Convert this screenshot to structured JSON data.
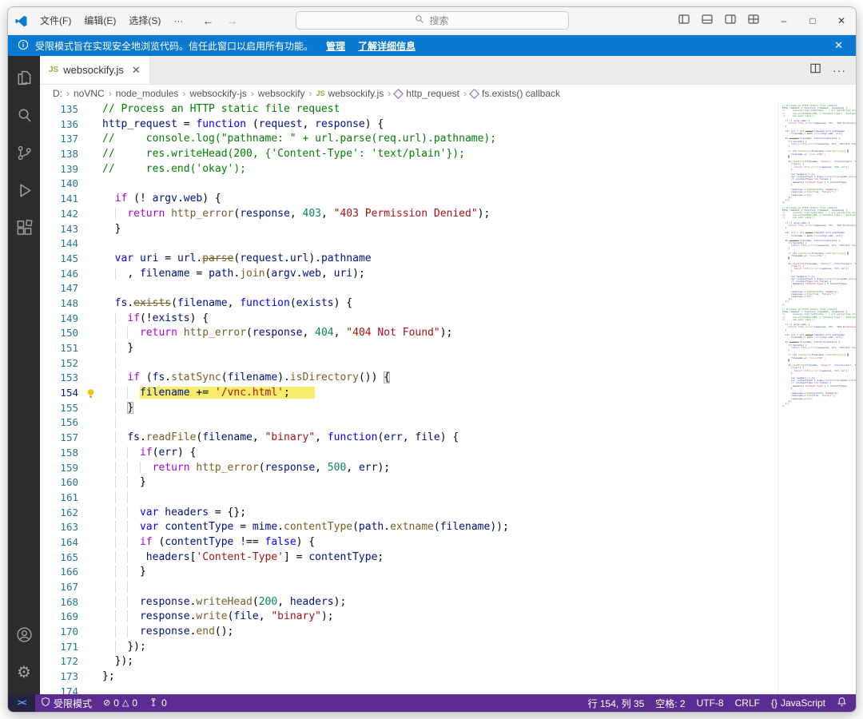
{
  "colors": {
    "status_bar": "#5c2d91",
    "banner": "#0a79d1",
    "activity_bar": "#2c2c2c",
    "highlight": "#f7ec6c",
    "accent_blue": "#0c7bd6"
  },
  "titlebar": {
    "menus": [
      "文件(F)",
      "编辑(E)",
      "选择(S)",
      "···"
    ],
    "nav": {
      "back": "←",
      "forward": "→"
    },
    "search_placeholder": "搜索",
    "window_controls": {
      "minimize": "–",
      "maximize": "□",
      "close": "✕"
    }
  },
  "banner": {
    "message": "受限模式旨在实现安全地浏览代码。信任此窗口以启用所有功能。",
    "manage_link": "管理",
    "learn_more_link": "了解详细信息",
    "close": "✕"
  },
  "activity_bar": {
    "items": [
      "explorer",
      "search",
      "source-control",
      "run-and-debug",
      "extensions",
      "account",
      "settings"
    ]
  },
  "tab": {
    "icon_label": "JS",
    "label": "websockify.js",
    "close": "✕"
  },
  "breadcrumb": {
    "items": [
      {
        "label": "D:"
      },
      {
        "label": "noVNC"
      },
      {
        "label": "node_modules"
      },
      {
        "label": "websockify-js"
      },
      {
        "label": "websockify"
      },
      {
        "label": "websockify.js",
        "icon": "js"
      },
      {
        "label": "http_request",
        "icon": "symbol"
      },
      {
        "label": "fs.exists() callback",
        "icon": "symbol"
      }
    ]
  },
  "code": {
    "lines": [
      {
        "n": 135,
        "i": 0,
        "t": [
          [
            "c",
            "// Process an HTTP static file request"
          ]
        ]
      },
      {
        "n": 136,
        "i": 0,
        "t": [
          [
            "v",
            "http_request"
          ],
          [
            "p",
            " = "
          ],
          [
            "k",
            "function"
          ],
          [
            "p",
            " ("
          ],
          [
            "v",
            "request"
          ],
          [
            "p",
            ", "
          ],
          [
            "v",
            "response"
          ],
          [
            "p",
            ") {"
          ]
        ]
      },
      {
        "n": 137,
        "i": 0,
        "t": [
          [
            "c",
            "//     console.log(\"pathname: \" + url.parse(req.url).pathname);"
          ]
        ]
      },
      {
        "n": 138,
        "i": 0,
        "t": [
          [
            "c",
            "//     res.writeHead(200, {'Content-Type': 'text/plain'});"
          ]
        ]
      },
      {
        "n": 139,
        "i": 0,
        "t": [
          [
            "c",
            "//     res.end('okay');"
          ]
        ]
      },
      {
        "n": 140,
        "i": 2,
        "t": []
      },
      {
        "n": 141,
        "i": 2,
        "t": [
          [
            "kc",
            "if"
          ],
          [
            "p",
            " (! "
          ],
          [
            "v",
            "argv"
          ],
          [
            "p",
            "."
          ],
          [
            "v",
            "web"
          ],
          [
            "p",
            ") {"
          ]
        ]
      },
      {
        "n": 142,
        "i": 4,
        "t": [
          [
            "kc",
            "return"
          ],
          [
            "p",
            " "
          ],
          [
            "f",
            "http_error"
          ],
          [
            "p",
            "("
          ],
          [
            "v",
            "response"
          ],
          [
            "p",
            ", "
          ],
          [
            "n",
            "403"
          ],
          [
            "p",
            ", "
          ],
          [
            "s",
            "\"403 Permission Denied\""
          ],
          [
            "p",
            ");"
          ]
        ]
      },
      {
        "n": 143,
        "i": 2,
        "t": [
          [
            "p",
            "}"
          ]
        ]
      },
      {
        "n": 144,
        "i": 2,
        "t": []
      },
      {
        "n": 145,
        "i": 2,
        "t": [
          [
            "k",
            "var"
          ],
          [
            "p",
            " "
          ],
          [
            "v",
            "uri"
          ],
          [
            "p",
            " = "
          ],
          [
            "v",
            "url"
          ],
          [
            "p",
            "."
          ],
          [
            "fd",
            "parse"
          ],
          [
            "p",
            "("
          ],
          [
            "v",
            "request"
          ],
          [
            "p",
            "."
          ],
          [
            "v",
            "url"
          ],
          [
            "p",
            ")."
          ],
          [
            "v",
            "pathname"
          ]
        ]
      },
      {
        "n": 146,
        "i": 4,
        "t": [
          [
            "p",
            ", "
          ],
          [
            "v",
            "filename"
          ],
          [
            "p",
            " = "
          ],
          [
            "v",
            "path"
          ],
          [
            "p",
            "."
          ],
          [
            "f",
            "join"
          ],
          [
            "p",
            "("
          ],
          [
            "v",
            "argv"
          ],
          [
            "p",
            "."
          ],
          [
            "v",
            "web"
          ],
          [
            "p",
            ", "
          ],
          [
            "v",
            "uri"
          ],
          [
            "p",
            ");"
          ]
        ]
      },
      {
        "n": 147,
        "i": 2,
        "t": []
      },
      {
        "n": 148,
        "i": 2,
        "t": [
          [
            "v",
            "fs"
          ],
          [
            "p",
            "."
          ],
          [
            "fd",
            "exists"
          ],
          [
            "p",
            "("
          ],
          [
            "v",
            "filename"
          ],
          [
            "p",
            ", "
          ],
          [
            "k",
            "function"
          ],
          [
            "p",
            "("
          ],
          [
            "v",
            "exists"
          ],
          [
            "p",
            ") {"
          ]
        ]
      },
      {
        "n": 149,
        "i": 4,
        "t": [
          [
            "kc",
            "if"
          ],
          [
            "p",
            "(!"
          ],
          [
            "v",
            "exists"
          ],
          [
            "p",
            ") {"
          ]
        ]
      },
      {
        "n": 150,
        "i": 6,
        "t": [
          [
            "kc",
            "return"
          ],
          [
            "p",
            " "
          ],
          [
            "f",
            "http_error"
          ],
          [
            "p",
            "("
          ],
          [
            "v",
            "response"
          ],
          [
            "p",
            ", "
          ],
          [
            "n",
            "404"
          ],
          [
            "p",
            ", "
          ],
          [
            "s",
            "\"404 Not Found\""
          ],
          [
            "p",
            ");"
          ]
        ]
      },
      {
        "n": 151,
        "i": 4,
        "t": [
          [
            "p",
            "}"
          ]
        ]
      },
      {
        "n": 152,
        "i": 4,
        "t": []
      },
      {
        "n": 153,
        "i": 4,
        "t": [
          [
            "kc",
            "if"
          ],
          [
            "p",
            " ("
          ],
          [
            "v",
            "fs"
          ],
          [
            "p",
            "."
          ],
          [
            "f",
            "statSync"
          ],
          [
            "p",
            "("
          ],
          [
            "v",
            "filename"
          ],
          [
            "p",
            ")."
          ],
          [
            "f",
            "isDirectory"
          ],
          [
            "p",
            "()) "
          ],
          [
            "bm",
            "{"
          ]
        ]
      },
      {
        "n": 154,
        "i": 6,
        "hl": true,
        "bulb": true,
        "cur": true,
        "t": [
          [
            "v",
            "filename"
          ],
          [
            "p",
            " += "
          ],
          [
            "s",
            "'/vnc.html'"
          ],
          [
            "p",
            ";    "
          ]
        ]
      },
      {
        "n": 155,
        "i": 4,
        "t": [
          [
            "bm",
            "}"
          ]
        ]
      },
      {
        "n": 156,
        "i": 4,
        "t": []
      },
      {
        "n": 157,
        "i": 4,
        "t": [
          [
            "v",
            "fs"
          ],
          [
            "p",
            "."
          ],
          [
            "f",
            "readFile"
          ],
          [
            "p",
            "("
          ],
          [
            "v",
            "filename"
          ],
          [
            "p",
            ", "
          ],
          [
            "s",
            "\"binary\""
          ],
          [
            "p",
            ", "
          ],
          [
            "k",
            "function"
          ],
          [
            "p",
            "("
          ],
          [
            "v",
            "err"
          ],
          [
            "p",
            ", "
          ],
          [
            "v",
            "file"
          ],
          [
            "p",
            ") {"
          ]
        ]
      },
      {
        "n": 158,
        "i": 6,
        "t": [
          [
            "kc",
            "if"
          ],
          [
            "p",
            "("
          ],
          [
            "v",
            "err"
          ],
          [
            "p",
            ") {"
          ]
        ]
      },
      {
        "n": 159,
        "i": 8,
        "t": [
          [
            "kc",
            "return"
          ],
          [
            "p",
            " "
          ],
          [
            "f",
            "http_error"
          ],
          [
            "p",
            "("
          ],
          [
            "v",
            "response"
          ],
          [
            "p",
            ", "
          ],
          [
            "n",
            "500"
          ],
          [
            "p",
            ", "
          ],
          [
            "v",
            "err"
          ],
          [
            "p",
            ");"
          ]
        ]
      },
      {
        "n": 160,
        "i": 6,
        "t": [
          [
            "p",
            "}"
          ]
        ]
      },
      {
        "n": 161,
        "i": 6,
        "t": []
      },
      {
        "n": 162,
        "i": 6,
        "t": [
          [
            "k",
            "var"
          ],
          [
            "p",
            " "
          ],
          [
            "v",
            "headers"
          ],
          [
            "p",
            " = {};"
          ]
        ]
      },
      {
        "n": 163,
        "i": 6,
        "t": [
          [
            "k",
            "var"
          ],
          [
            "p",
            " "
          ],
          [
            "v",
            "contentType"
          ],
          [
            "p",
            " = "
          ],
          [
            "v",
            "mime"
          ],
          [
            "p",
            "."
          ],
          [
            "f",
            "contentType"
          ],
          [
            "p",
            "("
          ],
          [
            "v",
            "path"
          ],
          [
            "p",
            "."
          ],
          [
            "f",
            "extname"
          ],
          [
            "p",
            "("
          ],
          [
            "v",
            "filename"
          ],
          [
            "p",
            "));"
          ]
        ]
      },
      {
        "n": 164,
        "i": 6,
        "t": [
          [
            "kc",
            "if"
          ],
          [
            "p",
            " ("
          ],
          [
            "v",
            "contentType"
          ],
          [
            "p",
            " !== "
          ],
          [
            "k",
            "false"
          ],
          [
            "p",
            ") {"
          ]
        ]
      },
      {
        "n": 165,
        "i": 7,
        "t": [
          [
            "v",
            "headers"
          ],
          [
            "p",
            "["
          ],
          [
            "s",
            "'Content-Type'"
          ],
          [
            "p",
            "] = "
          ],
          [
            "v",
            "contentType"
          ],
          [
            "p",
            ";"
          ]
        ]
      },
      {
        "n": 166,
        "i": 6,
        "t": [
          [
            "p",
            "}"
          ]
        ]
      },
      {
        "n": 167,
        "i": 6,
        "t": []
      },
      {
        "n": 168,
        "i": 6,
        "t": [
          [
            "v",
            "response"
          ],
          [
            "p",
            "."
          ],
          [
            "f",
            "writeHead"
          ],
          [
            "p",
            "("
          ],
          [
            "n",
            "200"
          ],
          [
            "p",
            ", "
          ],
          [
            "v",
            "headers"
          ],
          [
            "p",
            ");"
          ]
        ]
      },
      {
        "n": 169,
        "i": 6,
        "t": [
          [
            "v",
            "response"
          ],
          [
            "p",
            "."
          ],
          [
            "f",
            "write"
          ],
          [
            "p",
            "("
          ],
          [
            "v",
            "file"
          ],
          [
            "p",
            ", "
          ],
          [
            "s",
            "\"binary\""
          ],
          [
            "p",
            ");"
          ]
        ]
      },
      {
        "n": 170,
        "i": 6,
        "t": [
          [
            "v",
            "response"
          ],
          [
            "p",
            "."
          ],
          [
            "f",
            "end"
          ],
          [
            "p",
            "();"
          ]
        ]
      },
      {
        "n": 171,
        "i": 4,
        "t": [
          [
            "p",
            "});"
          ]
        ]
      },
      {
        "n": 172,
        "i": 2,
        "t": [
          [
            "p",
            "});"
          ]
        ]
      },
      {
        "n": 173,
        "i": 0,
        "t": [
          [
            "p",
            "};"
          ]
        ]
      },
      {
        "n": 174,
        "i": 0,
        "t": []
      }
    ]
  },
  "status_bar": {
    "remote_indicator": "><",
    "restricted_label": "受限模式",
    "errors": "0",
    "warnings": "0",
    "ports": "0",
    "cursor": "行 154, 列 35",
    "indentation": "空格: 2",
    "encoding": "UTF-8",
    "eol": "CRLF",
    "braces": "{}",
    "language": "JavaScript"
  }
}
